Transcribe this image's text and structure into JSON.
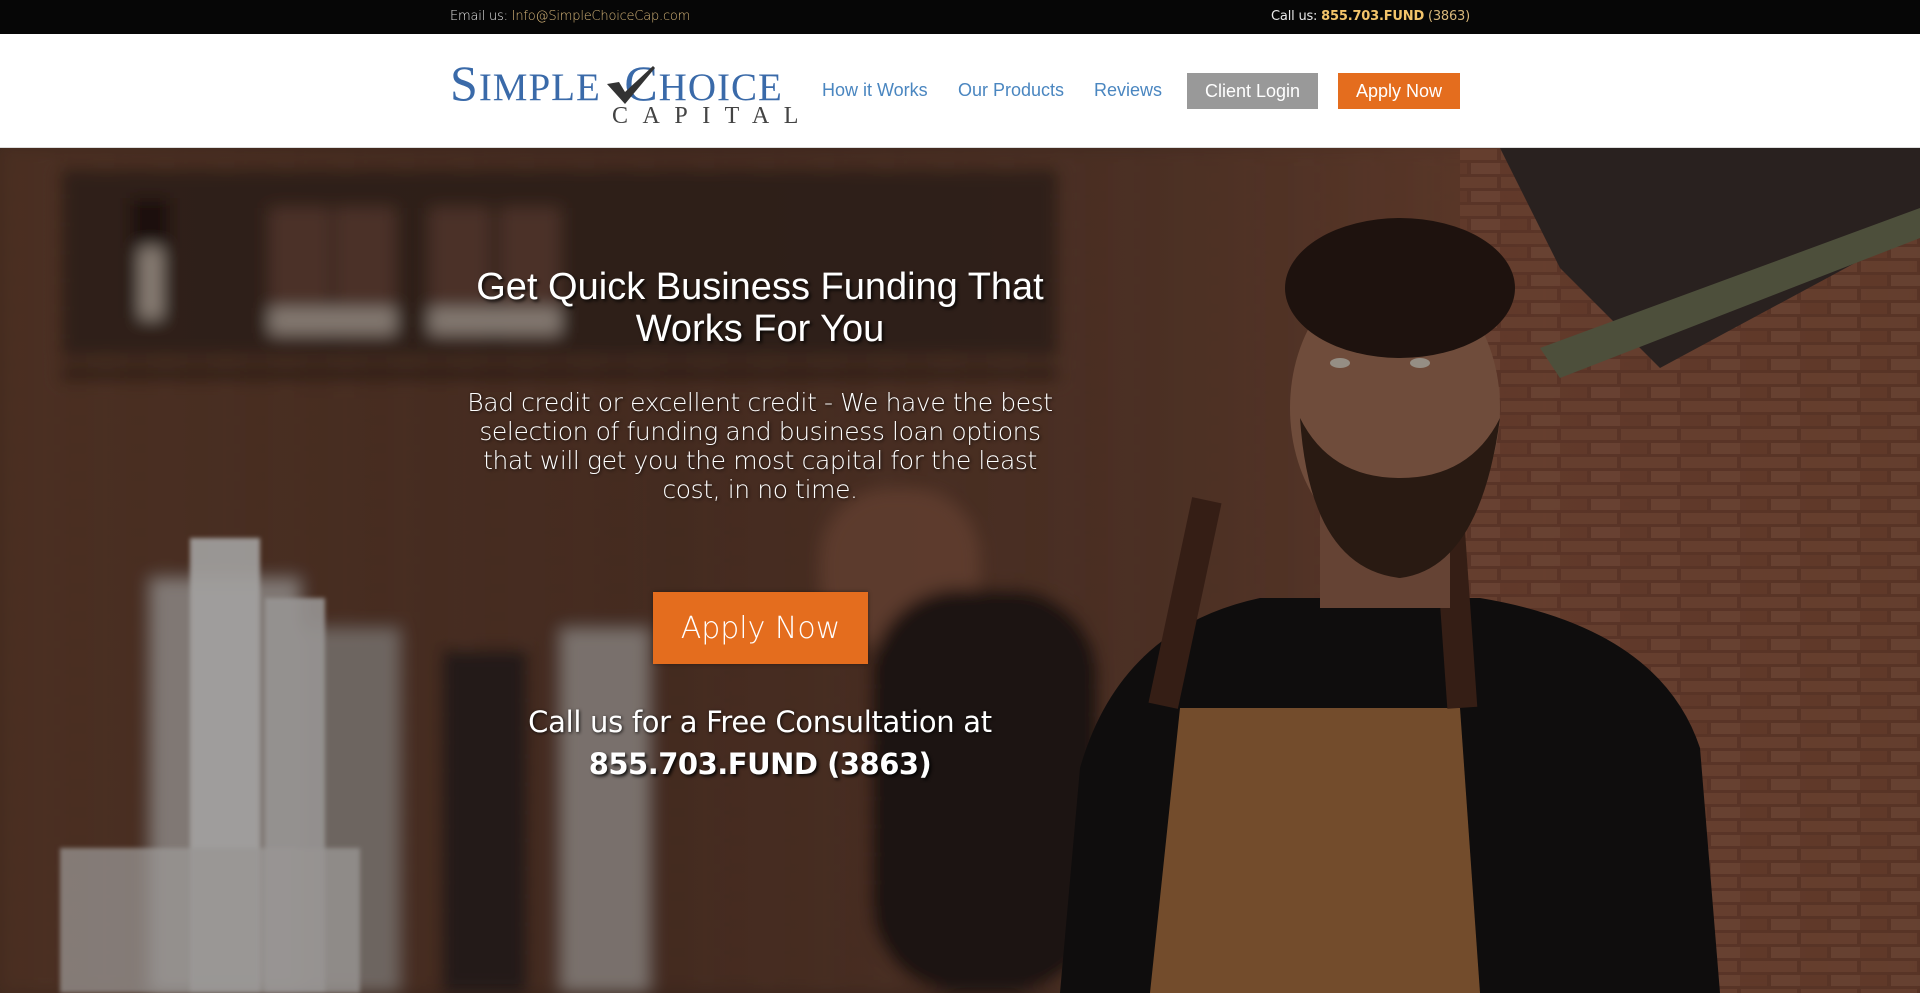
{
  "topbar": {
    "email_label": "Email us: ",
    "email_value": "Info@SimpleChoiceCap.com",
    "phone_label": "Call us: ",
    "phone_value": "855.703.FUND",
    "phone_ext": " (3863)"
  },
  "header": {
    "logo": {
      "line1_simple": "SIMPLE",
      "line1_choice": "CHOICE",
      "line2": "CAPITAL"
    },
    "nav": [
      {
        "label": "How it Works"
      },
      {
        "label": "Our Products"
      },
      {
        "label": "Reviews"
      }
    ],
    "client_login_label": "Client Login",
    "apply_now_label": "Apply Now"
  },
  "hero": {
    "title": "Get Quick Business Funding That Works For You",
    "subtitle": "Bad credit or excellent credit - We have the best selection of funding and business loan options that will get you the most capital for the least cost, in no time.",
    "apply_now_label": "Apply Now",
    "call_text": "Call us for a Free Consultation at",
    "phone_text": "855.703.FUND (3863)"
  },
  "colors": {
    "accent_orange": "#e46d1e",
    "nav_blue": "#4a86c0",
    "logo_blue": "#3a6aa9",
    "login_gray": "#999999",
    "topbar_bg": "#060606",
    "gold": "#d8b77a"
  }
}
